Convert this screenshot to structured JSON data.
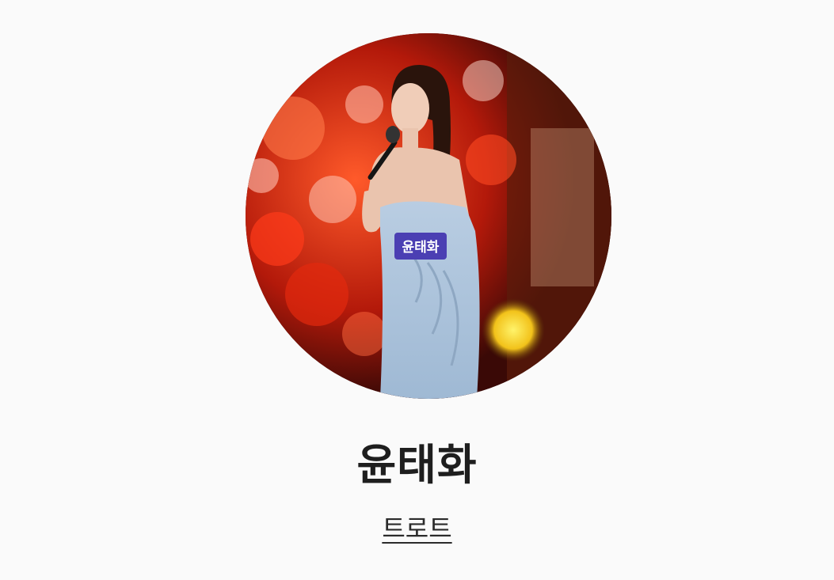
{
  "profile": {
    "avatar_icon": "artist-photo",
    "name": "윤태화",
    "genre": "트로트",
    "sash_text": "윤태화"
  },
  "colors": {
    "background": "#fafafa",
    "name_text": "#1e1e1e",
    "genre_text": "#2b2b2b",
    "stage_red": "#c8200c",
    "dress_blue": "#a9c3dc",
    "sash_purple": "#4b3fb3"
  }
}
